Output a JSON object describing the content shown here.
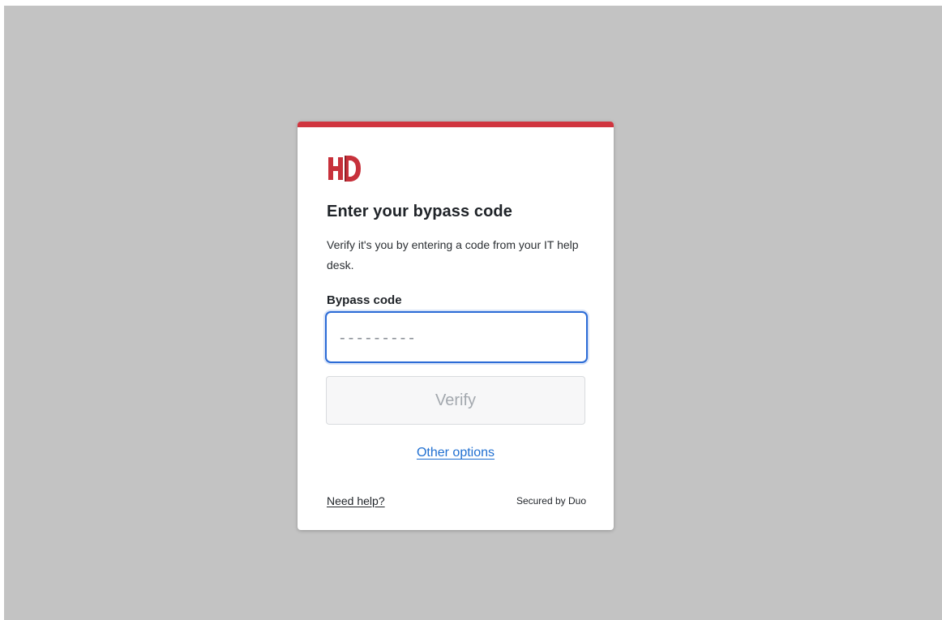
{
  "colors": {
    "page_background": "#c3c3c3",
    "accent": "#d0353f",
    "focus": "#2b6bd6",
    "link": "#1f6fd1"
  },
  "logo": {
    "icon": "hd-logo-icon"
  },
  "heading": "Enter your bypass code",
  "description": "Verify it's you by entering a code from your IT help desk.",
  "bypass": {
    "label": "Bypass code",
    "value": "",
    "placeholder": "---------"
  },
  "verify_button": {
    "label": "Verify",
    "disabled": true
  },
  "other_options": "Other options",
  "footer": {
    "help_link": "Need help?",
    "secured_by": "Secured by Duo"
  }
}
